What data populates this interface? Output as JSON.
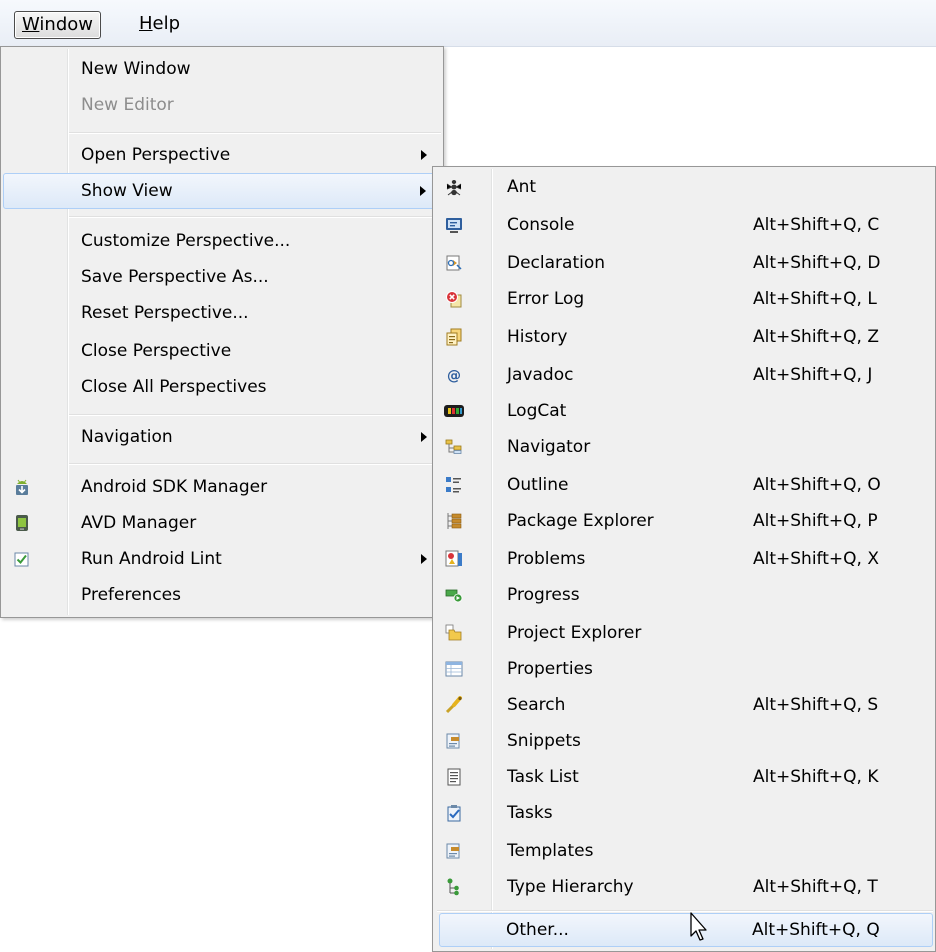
{
  "menubar": {
    "window": "Window",
    "help": "Help"
  },
  "window_menu": {
    "new_window": "New Window",
    "new_editor": "New Editor",
    "open_perspective": "Open Perspective",
    "show_view": "Show View",
    "customize_perspective": "Customize Perspective...",
    "save_perspective_as": "Save Perspective As...",
    "reset_perspective": "Reset Perspective...",
    "close_perspective": "Close Perspective",
    "close_all_perspectives": "Close All Perspectives",
    "navigation": "Navigation",
    "android_sdk_manager": "Android SDK Manager",
    "avd_manager": "AVD Manager",
    "run_android_lint": "Run Android Lint",
    "preferences": "Preferences"
  },
  "show_view_menu": [
    {
      "label": "Ant",
      "shortcut": "",
      "icon": "ant-icon"
    },
    {
      "label": "Console",
      "shortcut": "Alt+Shift+Q, C",
      "icon": "console-icon"
    },
    {
      "label": "Declaration",
      "shortcut": "Alt+Shift+Q, D",
      "icon": "declaration-icon"
    },
    {
      "label": "Error Log",
      "shortcut": "Alt+Shift+Q, L",
      "icon": "error-log-icon"
    },
    {
      "label": "History",
      "shortcut": "Alt+Shift+Q, Z",
      "icon": "history-icon"
    },
    {
      "label": "Javadoc",
      "shortcut": "Alt+Shift+Q, J",
      "icon": "javadoc-icon"
    },
    {
      "label": "LogCat",
      "shortcut": "",
      "icon": "logcat-icon"
    },
    {
      "label": "Navigator",
      "shortcut": "",
      "icon": "navigator-icon"
    },
    {
      "label": "Outline",
      "shortcut": "Alt+Shift+Q, O",
      "icon": "outline-icon"
    },
    {
      "label": "Package Explorer",
      "shortcut": "Alt+Shift+Q, P",
      "icon": "package-explorer-icon"
    },
    {
      "label": "Problems",
      "shortcut": "Alt+Shift+Q, X",
      "icon": "problems-icon"
    },
    {
      "label": "Progress",
      "shortcut": "",
      "icon": "progress-icon"
    },
    {
      "label": "Project Explorer",
      "shortcut": "",
      "icon": "project-explorer-icon"
    },
    {
      "label": "Properties",
      "shortcut": "",
      "icon": "properties-icon"
    },
    {
      "label": "Search",
      "shortcut": "Alt+Shift+Q, S",
      "icon": "search-icon"
    },
    {
      "label": "Snippets",
      "shortcut": "",
      "icon": "snippets-icon"
    },
    {
      "label": "Task List",
      "shortcut": "Alt+Shift+Q, K",
      "icon": "task-list-icon"
    },
    {
      "label": "Tasks",
      "shortcut": "",
      "icon": "tasks-icon"
    },
    {
      "label": "Templates",
      "shortcut": "",
      "icon": "templates-icon"
    },
    {
      "label": "Type Hierarchy",
      "shortcut": "Alt+Shift+Q, T",
      "icon": "type-hierarchy-icon"
    },
    {
      "label": "Other...",
      "shortcut": "Alt+Shift+Q, Q",
      "icon": ""
    }
  ],
  "colors": {
    "menu_bg": "#f0f0f0",
    "highlight_bg": "#dde9f8",
    "highlight_border": "#aecff7",
    "disabled_text": "#8d8d8d",
    "android_green": "#7fb02e"
  }
}
